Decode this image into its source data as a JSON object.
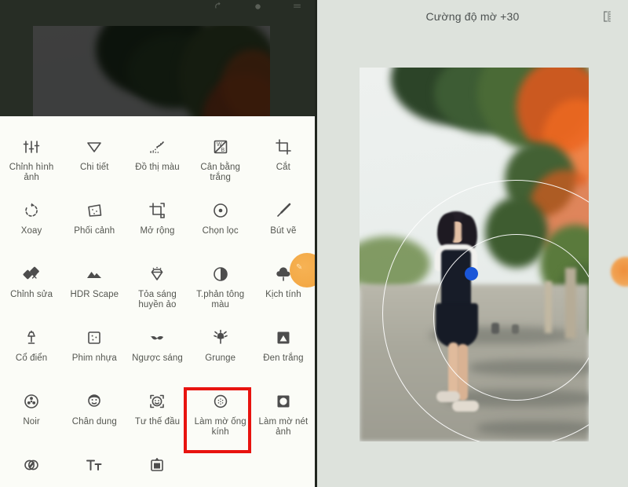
{
  "app": {
    "left_panel": {
      "sheet_open": true,
      "topbar_icons": [
        "undo-icon",
        "redo-icon",
        "menu-icon"
      ],
      "tools": [
        {
          "label": "Chỉnh hình ảnh",
          "icon": "tune-sliders-icon"
        },
        {
          "label": "Chi tiết",
          "icon": "details-triangle-icon"
        },
        {
          "label": "Đồ thị màu",
          "icon": "curves-icon"
        },
        {
          "label": "Cân bằng trắng",
          "icon": "white-balance-icon"
        },
        {
          "label": "Cắt",
          "icon": "crop-icon"
        },
        {
          "label": "Xoay",
          "icon": "rotate-icon"
        },
        {
          "label": "Phối cảnh",
          "icon": "perspective-icon"
        },
        {
          "label": "Mở rộng",
          "icon": "expand-icon"
        },
        {
          "label": "Chọn lọc",
          "icon": "selective-icon"
        },
        {
          "label": "Bút vẽ",
          "icon": "brush-icon"
        },
        {
          "label": "Chỉnh sửa",
          "icon": "healing-patch-icon"
        },
        {
          "label": "HDR Scape",
          "icon": "mountains-icon"
        },
        {
          "label": "Tỏa sáng huyền ảo",
          "icon": "glamour-glow-icon"
        },
        {
          "label": "T.phản tông màu",
          "icon": "tonal-contrast-icon"
        },
        {
          "label": "Kịch tính",
          "icon": "drama-cloud-icon"
        },
        {
          "label": "Cổ điển",
          "icon": "vintage-lamp-icon"
        },
        {
          "label": "Phim nhựa",
          "icon": "grainy-film-icon"
        },
        {
          "label": "Ngược sáng",
          "icon": "retrolux-moustache-icon"
        },
        {
          "label": "Grunge",
          "icon": "grunge-icon"
        },
        {
          "label": "Đen trắng",
          "icon": "black-white-icon"
        },
        {
          "label": "Noir",
          "icon": "noir-reel-icon"
        },
        {
          "label": "Chân dung",
          "icon": "portrait-face-icon"
        },
        {
          "label": "Tư thế đầu",
          "icon": "head-pose-icon"
        },
        {
          "label": "Làm mờ ống kính",
          "icon": "lens-blur-icon"
        },
        {
          "label": "Làm mờ nét ảnh",
          "icon": "vignette-icon"
        },
        {
          "label": "",
          "icon": "double-exposure-icon"
        },
        {
          "label": "",
          "icon": "text-tool-icon"
        },
        {
          "label": "",
          "icon": "frames-icon"
        }
      ],
      "highlighted_tool": "Làm mờ ống kính",
      "highlight_color": "#e8130f",
      "fab": {
        "name": "edit-fab",
        "glyph": "✎",
        "color": "#f4ab49"
      }
    },
    "right_panel": {
      "title": "Cường độ mờ +30",
      "compare_icon": "compare-icon",
      "overlay": {
        "focus_dot_color": "#1a56d8",
        "ring_color": "#ffffff",
        "rings": 2
      },
      "fab": {
        "name": "apply-fab",
        "color": "#f0a050"
      }
    }
  }
}
